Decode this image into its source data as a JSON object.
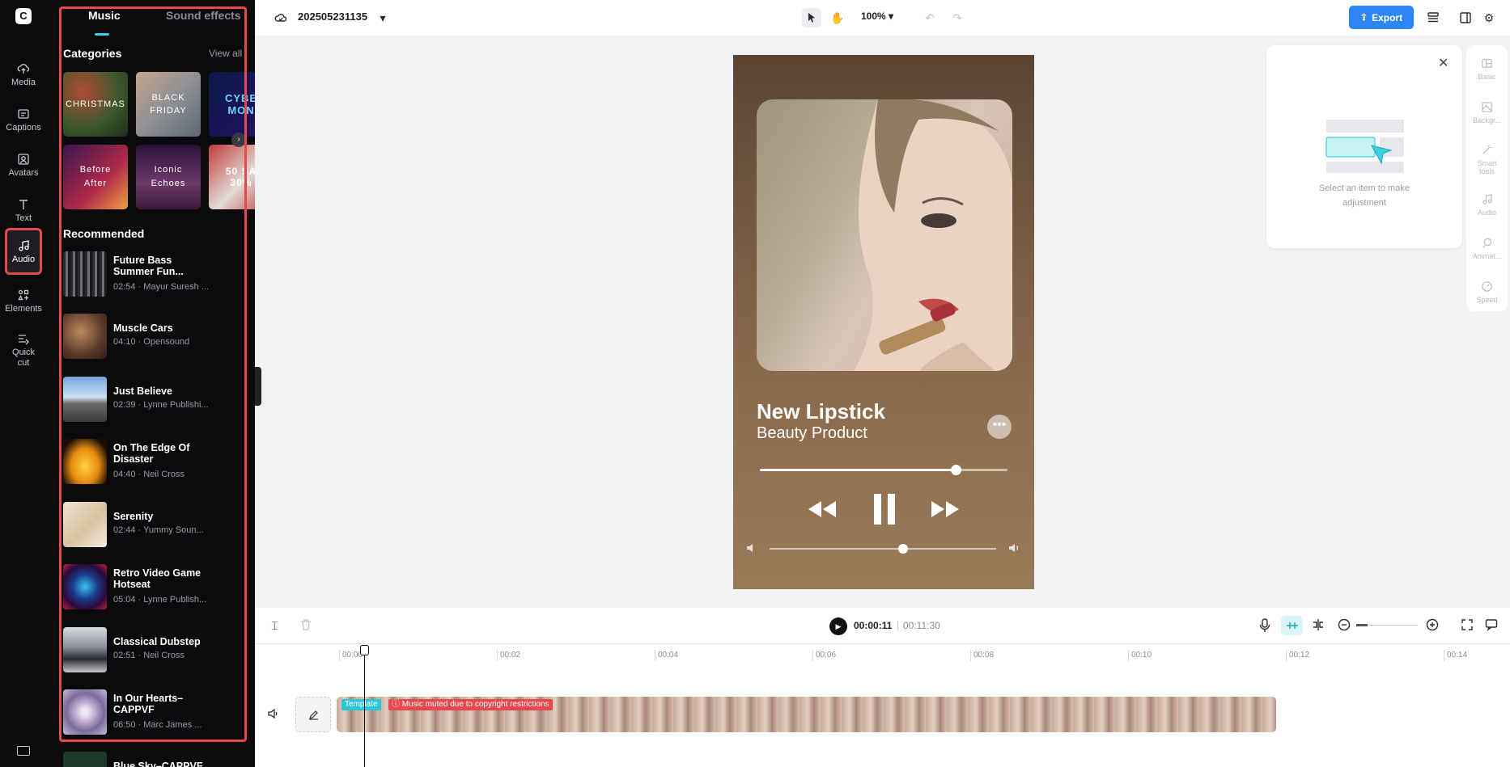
{
  "app": {
    "logo_glyph": "C"
  },
  "rail": [
    {
      "label": "Media",
      "icon": "cloud-upload-icon"
    },
    {
      "label": "Captions",
      "icon": "captions-icon"
    },
    {
      "label": "Avatars",
      "icon": "avatar-icon"
    },
    {
      "label": "Text",
      "icon": "text-icon"
    },
    {
      "label": "Audio",
      "icon": "music-note-icon",
      "active": true
    },
    {
      "label": "Elements",
      "icon": "elements-icon"
    },
    {
      "label": "Quick cut",
      "icon": "quick-cut-icon"
    }
  ],
  "panel": {
    "tabs": [
      "Music",
      "Sound effects"
    ],
    "categories_title": "Categories",
    "view_all": "View all",
    "categories": [
      {
        "label": "CHRISTMAS"
      },
      {
        "label": "BLACK FRIDAY"
      },
      {
        "label": "CYBE MON"
      },
      {
        "label": "Before After"
      },
      {
        "label": "Iconic Echoes"
      },
      {
        "label": "50 SA 30%"
      }
    ],
    "recommended_title": "Recommended",
    "tracks": [
      {
        "title": "Future Bass Summer Fun...",
        "meta": "02:54 · Mayur Suresh ..."
      },
      {
        "title": "Muscle Cars",
        "meta": "04:10 · Opensound"
      },
      {
        "title": "Just Believe",
        "meta": "02:39 · Lynne Publishi..."
      },
      {
        "title": "On The Edge Of Disaster",
        "meta": "04:40 · Neil Cross"
      },
      {
        "title": "Serenity",
        "meta": "02:44 · Yummy Soun..."
      },
      {
        "title": "Retro Video Game Hotseat",
        "meta": "05:04 · Lynne Publish..."
      },
      {
        "title": "Classical Dubstep",
        "meta": "02:51 · Neil Cross"
      },
      {
        "title": "In Our Hearts–CAPPVF",
        "meta": "06:50 · Marc James ..."
      },
      {
        "title": "Blue Sky–CAPPVF",
        "meta": ""
      }
    ]
  },
  "topbar": {
    "project_name": "202505231135",
    "zoom": "100%",
    "export_label": "Export"
  },
  "canvas": {
    "title": "New Lipstick",
    "subtitle": "Beauty Product",
    "more": "•••",
    "seek_progress": 0.79,
    "volume_level": 0.59
  },
  "inspector": {
    "hint": "Select an item to make adjustment",
    "items": [
      "Basic",
      "Backgr...",
      "Smart tools",
      "Audio",
      "Animat...",
      "Speed"
    ]
  },
  "timeline": {
    "current_time": "00:00:11",
    "separator": "|",
    "total_time": "00:11:30",
    "ruler": [
      "00:00",
      "00:02",
      "00:04",
      "00:06",
      "00:08",
      "00:10",
      "00:12",
      "00:14"
    ],
    "clip_badge": "Template",
    "clip_warning": "Music muted due to copyright restrictions"
  },
  "colors": {
    "accent": "#2fd3e6",
    "export": "#2e86f5",
    "highlight": "#e5484d"
  }
}
